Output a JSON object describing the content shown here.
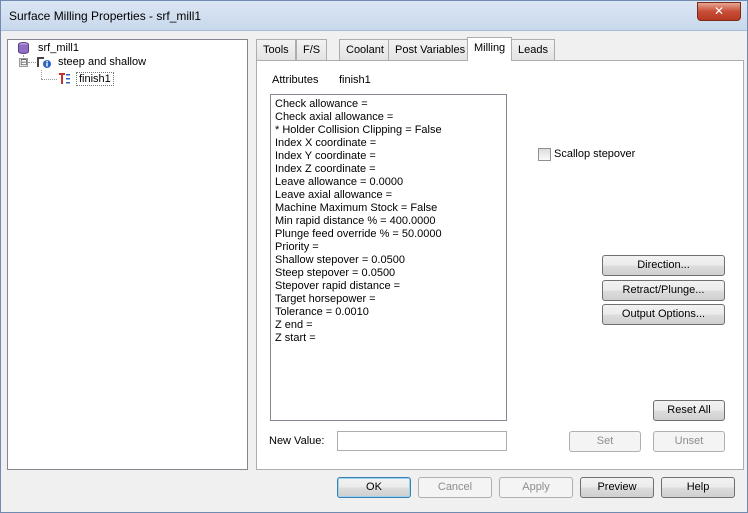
{
  "window": {
    "title": "Surface Milling Properties - srf_mill1",
    "close_glyph": "✕"
  },
  "tree": {
    "root": {
      "label": "srf_mill1",
      "icon": "database-icon"
    },
    "child": {
      "label": "steep and shallow",
      "icon": "operation-info-icon",
      "expander": "⊟"
    },
    "grandchild": {
      "label": "finish1",
      "icon": "tool-path-icon"
    }
  },
  "tabs": [
    {
      "label": "Tools"
    },
    {
      "label": "F/S"
    },
    {
      "label": "Coolant"
    },
    {
      "label": "Post Variables"
    },
    {
      "label": "Milling",
      "active": true
    },
    {
      "label": "Leads"
    }
  ],
  "panel": {
    "attributes_label": "Attributes",
    "attributes_value": "finish1",
    "rows": [
      "Check allowance =",
      "Check axial allowance =",
      "* Holder Collision Clipping = False",
      "Index X coordinate =",
      "Index Y coordinate =",
      "Index Z coordinate =",
      "Leave allowance = 0.0000",
      "Leave axial allowance =",
      "Machine Maximum Stock = False",
      "Min rapid distance % = 400.0000",
      "Plunge feed override % = 50.0000",
      "Priority =",
      "Shallow stepover = 0.0500",
      "Steep stepover = 0.0500",
      "Stepover rapid distance =",
      "Target horsepower =",
      "Tolerance = 0.0010",
      "Z end =",
      "Z start ="
    ],
    "scallop_label": "Scallop stepover",
    "scallop_checked": false,
    "direction_button": "Direction...",
    "retract_button": "Retract/Plunge...",
    "output_button": "Output Options...",
    "reset_button": "Reset All",
    "new_value_label": "New Value:",
    "new_value": "",
    "set_button": "Set",
    "unset_button": "Unset"
  },
  "footer": {
    "ok": "OK",
    "cancel": "Cancel",
    "apply": "Apply",
    "preview": "Preview",
    "help": "Help"
  }
}
